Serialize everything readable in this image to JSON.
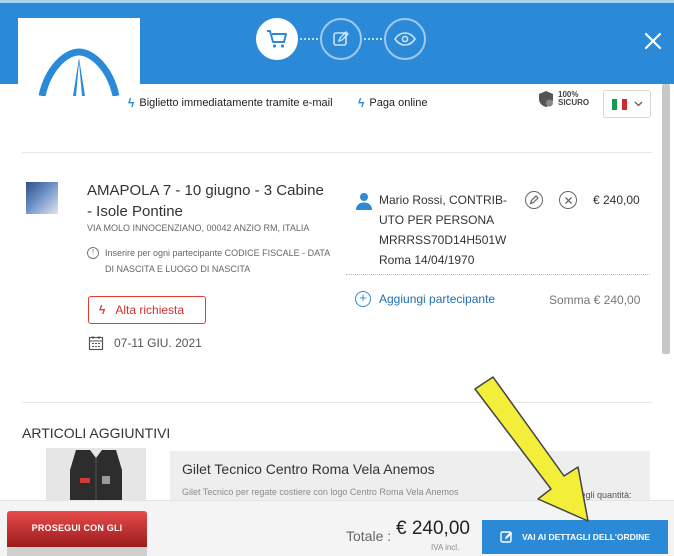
{
  "header": {
    "steps": [
      {
        "icon": "cart-icon",
        "active": true
      },
      {
        "icon": "edit-icon",
        "active": false
      },
      {
        "icon": "eye-icon",
        "active": false
      }
    ]
  },
  "infobar": {
    "ticket_email": "Biglietto immediatamente tramite e-mail",
    "pay_online": "Paga online",
    "secure_pct": "100%",
    "secure_label": "SICURO",
    "language_flag": "Italy"
  },
  "product": {
    "title": "AMAPOLA 7 - 10 giugno - 3 Cabine - Isole Pontine",
    "address": "VIA MOLO INNOCENZIANO, 00042 ANZIO RM, ITALIA",
    "note": "Inserire per ogni partecipante CODICE FISCALE - DATA DI NASCITA E LUOGO DI NASCITA",
    "badge": "Alta richiesta",
    "date": "07-11 GIU. 2021"
  },
  "participant": {
    "details": "Mario Rossi, CONTRIB-UTO PER PERSONA MRRRSS70D14H501W Roma 14/04/1970",
    "price": "€ 240,00",
    "add_label": "Aggiungi partecipante",
    "sum": "Somma € 240,00"
  },
  "extras": {
    "title": "ARTICOLI AGGIUNTIVI",
    "item_name": "Gilet Tecnico Centro Roma Vela Anemos",
    "item_desc": "Gilet Tecnico per regate costiere con logo Centro Roma Vela Anemos",
    "qty_label": "Scegli quantità:"
  },
  "footer": {
    "continue_label": "PROSEGUI CON GLI",
    "total_label": "Totale :",
    "total_value": "€ 240,00",
    "iva": "IVA incl.",
    "cta_label": "VAI AI DETTAGLI DELL'ORDINE"
  },
  "colors": {
    "primary": "#2a8ad8",
    "alert": "#e53935",
    "highlight_arrow": "#f3ee3a"
  }
}
